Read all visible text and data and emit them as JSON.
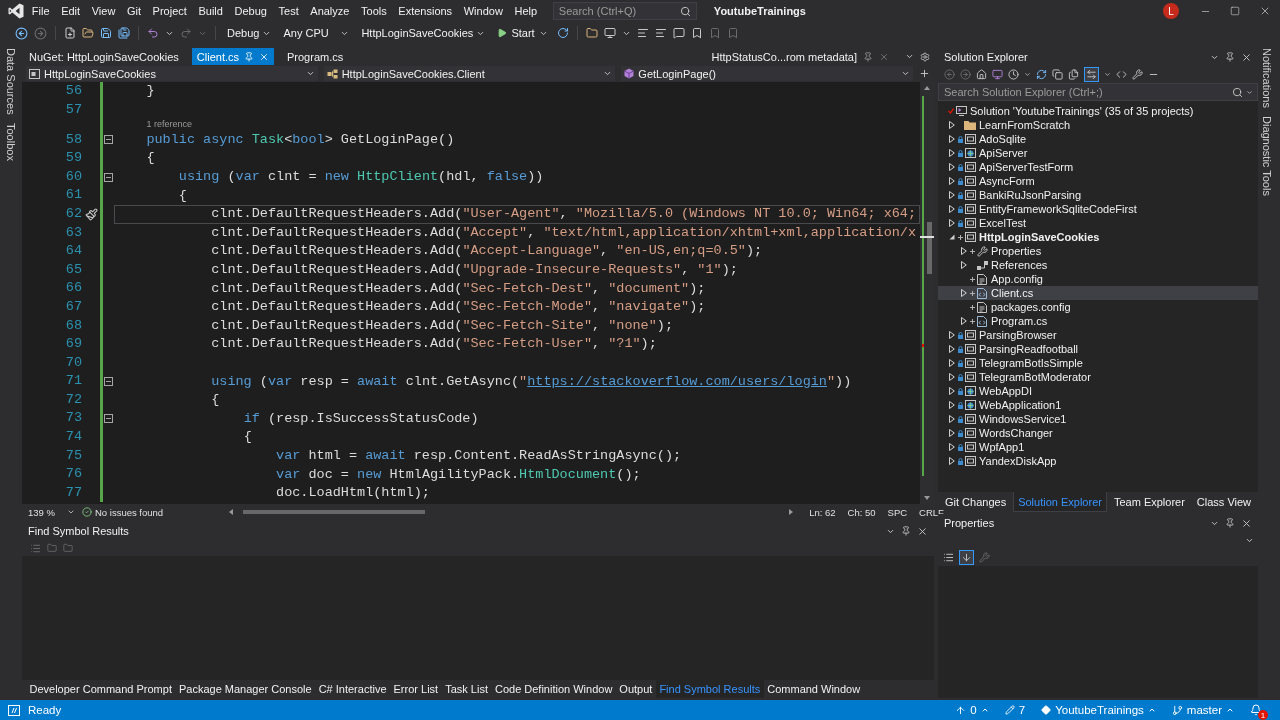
{
  "window": {
    "title": "YoutubeTrainings",
    "avatar": "L"
  },
  "menu": [
    "File",
    "Edit",
    "View",
    "Git",
    "Project",
    "Build",
    "Debug",
    "Test",
    "Analyze",
    "Tools",
    "Extensions",
    "Window",
    "Help"
  ],
  "search": {
    "placeholder": "Search (Ctrl+Q)"
  },
  "toolbar": {
    "configuration": "Debug",
    "platform": "Any CPU",
    "startup_project": "HttpLoginSaveCookies",
    "start": "Start"
  },
  "left_strip": [
    "Data Sources",
    "Toolbox"
  ],
  "editor": {
    "tabs": [
      {
        "label": "NuGet: HttpLoginSaveCookies",
        "selected": false
      },
      {
        "label": "Client.cs",
        "selected": true
      },
      {
        "label": "Program.cs",
        "selected": false
      }
    ],
    "preview_tab": {
      "label": "HttpStatusCo...rom metadata]"
    },
    "nav": [
      {
        "kind": "project",
        "label": "HttpLoginSaveCookies"
      },
      {
        "kind": "class",
        "label": "HttpLoginSaveCookies.Client"
      },
      {
        "kind": "method",
        "label": "GetLoginPage()"
      }
    ],
    "lines": [
      {
        "number": "56",
        "highlighted": false,
        "tokens": [
          {
            "kind": "plain",
            "text": "    }"
          }
        ]
      },
      {
        "number": "57",
        "highlighted": false
      },
      {
        "number": "58",
        "highlighted": false,
        "expanded": true,
        "codelens": "1 reference",
        "tokens": [
          {
            "kind": "keyword",
            "text": "    public async"
          },
          {
            "kind": "type",
            "text": " Task"
          },
          {
            "kind": "plain",
            "text": "<"
          },
          {
            "kind": "keyword",
            "text": "bool"
          },
          {
            "kind": "plain",
            "text": "> GetLoginPage()"
          }
        ]
      },
      {
        "number": "59",
        "highlighted": false,
        "tokens": [
          {
            "kind": "plain",
            "text": "    {"
          }
        ]
      },
      {
        "number": "60",
        "highlighted": false,
        "expanded": true,
        "tokens": [
          {
            "kind": "keyword",
            "text": "        using"
          },
          {
            "kind": "plain",
            "text": " ("
          },
          {
            "kind": "keyword",
            "text": "var"
          },
          {
            "kind": "plain",
            "text": " clnt = "
          },
          {
            "kind": "keyword",
            "text": "new"
          },
          {
            "kind": "type",
            "text": " HttpClient"
          },
          {
            "kind": "plain",
            "text": "(hdl, "
          },
          {
            "kind": "keyword",
            "text": "false"
          },
          {
            "kind": "plain",
            "text": "))"
          }
        ]
      },
      {
        "number": "61",
        "highlighted": false,
        "tokens": [
          {
            "kind": "plain",
            "text": "        {"
          }
        ]
      },
      {
        "number": "62",
        "highlighted": true,
        "tokens": [
          {
            "kind": "plain",
            "text": "            clnt.DefaultRequestHeaders.Add("
          },
          {
            "kind": "string",
            "text": "\"User-Agent\""
          },
          {
            "kind": "plain",
            "text": ", "
          },
          {
            "kind": "string",
            "text": "\"Mozilla/5.0 (Windows NT 10.0; Win64; x64;"
          }
        ]
      },
      {
        "number": "63",
        "highlighted": false,
        "tokens": [
          {
            "kind": "plain",
            "text": "            clnt.DefaultRequestHeaders.Add("
          },
          {
            "kind": "string",
            "text": "\"Accept\""
          },
          {
            "kind": "plain",
            "text": ", "
          },
          {
            "kind": "string",
            "text": "\"text/html,application/xhtml+xml,application/x"
          }
        ]
      },
      {
        "number": "64",
        "highlighted": false,
        "tokens": [
          {
            "kind": "plain",
            "text": "            clnt.DefaultRequestHeaders.Add("
          },
          {
            "kind": "string",
            "text": "\"Accept-Language\""
          },
          {
            "kind": "plain",
            "text": ", "
          },
          {
            "kind": "string",
            "text": "\"en-US,en;q=0.5\""
          },
          {
            "kind": "plain",
            "text": ");"
          }
        ]
      },
      {
        "number": "65",
        "highlighted": false,
        "tokens": [
          {
            "kind": "plain",
            "text": "            clnt.DefaultRequestHeaders.Add("
          },
          {
            "kind": "string",
            "text": "\"Upgrade-Insecure-Requests\""
          },
          {
            "kind": "plain",
            "text": ", "
          },
          {
            "kind": "string",
            "text": "\"1\""
          },
          {
            "kind": "plain",
            "text": ");"
          }
        ]
      },
      {
        "number": "66",
        "highlighted": false,
        "tokens": [
          {
            "kind": "plain",
            "text": "            clnt.DefaultRequestHeaders.Add("
          },
          {
            "kind": "string",
            "text": "\"Sec-Fetch-Dest\""
          },
          {
            "kind": "plain",
            "text": ", "
          },
          {
            "kind": "string",
            "text": "\"document\""
          },
          {
            "kind": "plain",
            "text": ");"
          }
        ]
      },
      {
        "number": "67",
        "highlighted": false,
        "tokens": [
          {
            "kind": "plain",
            "text": "            clnt.DefaultRequestHeaders.Add("
          },
          {
            "kind": "string",
            "text": "\"Sec-Fetch-Mode\""
          },
          {
            "kind": "plain",
            "text": ", "
          },
          {
            "kind": "string",
            "text": "\"navigate\""
          },
          {
            "kind": "plain",
            "text": ");"
          }
        ]
      },
      {
        "number": "68",
        "highlighted": false,
        "tokens": [
          {
            "kind": "plain",
            "text": "            clnt.DefaultRequestHeaders.Add("
          },
          {
            "kind": "string",
            "text": "\"Sec-Fetch-Site\""
          },
          {
            "kind": "plain",
            "text": ", "
          },
          {
            "kind": "string",
            "text": "\"none\""
          },
          {
            "kind": "plain",
            "text": ");"
          }
        ]
      },
      {
        "number": "69",
        "highlighted": false,
        "tokens": [
          {
            "kind": "plain",
            "text": "            clnt.DefaultRequestHeaders.Add("
          },
          {
            "kind": "string",
            "text": "\"Sec-Fetch-User\""
          },
          {
            "kind": "plain",
            "text": ", "
          },
          {
            "kind": "string",
            "text": "\"?1\""
          },
          {
            "kind": "plain",
            "text": ");"
          }
        ]
      },
      {
        "number": "70",
        "highlighted": false
      },
      {
        "number": "71",
        "highlighted": false,
        "expanded": true,
        "tokens": [
          {
            "kind": "keyword",
            "text": "            using"
          },
          {
            "kind": "plain",
            "text": " ("
          },
          {
            "kind": "keyword",
            "text": "var"
          },
          {
            "kind": "plain",
            "text": " resp = "
          },
          {
            "kind": "keyword",
            "text": "await"
          },
          {
            "kind": "plain",
            "text": " clnt.GetAsync("
          },
          {
            "kind": "string",
            "text": "\""
          },
          {
            "kind": "link",
            "text": "https://stackoverflow.com/users/login"
          },
          {
            "kind": "string",
            "text": "\""
          },
          {
            "kind": "plain",
            "text": "))"
          }
        ]
      },
      {
        "number": "72",
        "highlighted": false,
        "tokens": [
          {
            "kind": "plain",
            "text": "            {"
          }
        ]
      },
      {
        "number": "73",
        "highlighted": false,
        "expanded": true,
        "tokens": [
          {
            "kind": "keyword",
            "text": "                if"
          },
          {
            "kind": "plain",
            "text": " (resp.IsSuccessStatusCode)"
          }
        ]
      },
      {
        "number": "74",
        "highlighted": false,
        "tokens": [
          {
            "kind": "plain",
            "text": "                {"
          }
        ]
      },
      {
        "number": "75",
        "highlighted": false,
        "tokens": [
          {
            "kind": "keyword",
            "text": "                    var"
          },
          {
            "kind": "plain",
            "text": " html = "
          },
          {
            "kind": "keyword",
            "text": "await"
          },
          {
            "kind": "plain",
            "text": " resp.Content.ReadAsStringAsync();"
          }
        ]
      },
      {
        "number": "76",
        "highlighted": false,
        "tokens": [
          {
            "kind": "keyword",
            "text": "                    var"
          },
          {
            "kind": "plain",
            "text": " doc = "
          },
          {
            "kind": "keyword",
            "text": "new"
          },
          {
            "kind": "plain",
            "text": " HtmlAgilityPack."
          },
          {
            "kind": "type",
            "text": "HtmlDocument"
          },
          {
            "kind": "plain",
            "text": "();"
          }
        ]
      },
      {
        "number": "77",
        "highlighted": false,
        "tokens": [
          {
            "kind": "plain",
            "text": "                    doc.LoadHtml(html);"
          }
        ]
      }
    ],
    "status": {
      "zoom": "139 %",
      "issues": "No issues found",
      "line": "Ln: 62",
      "column": "Ch: 50",
      "indent": "SPC",
      "line_ending": "CRLF"
    }
  },
  "find_symbol_results": {
    "title": "Find Symbol Results"
  },
  "bottom_tabs": [
    {
      "label": "Developer Command Prompt",
      "selected": false
    },
    {
      "label": "Package Manager Console",
      "selected": false
    },
    {
      "label": "C# Interactive",
      "selected": false
    },
    {
      "label": "Error List",
      "selected": false
    },
    {
      "label": "Task List",
      "selected": false
    },
    {
      "label": "Code Definition Window",
      "selected": false
    },
    {
      "label": "Output",
      "selected": false
    },
    {
      "label": "Find Symbol Results",
      "selected": true
    },
    {
      "label": "Command Window",
      "selected": false
    }
  ],
  "solution_explorer": {
    "title": "Solution Explorer",
    "sync_active": true,
    "search": {
      "placeholder": "Search Solution Explorer (Ctrl+;)"
    },
    "tree": [
      {
        "label": "Solution 'YoutubeTrainings' (35 of 35 projects)",
        "kind": "solution",
        "modified": true,
        "selected": false,
        "children": [
          {
            "label": "LearnFromScratch",
            "kind": "folder",
            "expanded": false,
            "selected": false
          },
          {
            "label": "AdoSqlite",
            "kind": "project",
            "checked_in": true,
            "expanded": false,
            "selected": false
          },
          {
            "label": "ApiServer",
            "kind": "web_project",
            "checked_in": true,
            "expanded": false,
            "selected": false
          },
          {
            "label": "ApiServerTestForm",
            "kind": "project",
            "checked_in": true,
            "expanded": false,
            "selected": false
          },
          {
            "label": "AsyncForm",
            "kind": "project",
            "checked_in": true,
            "expanded": false,
            "selected": false
          },
          {
            "label": "BankiRuJsonParsing",
            "kind": "project",
            "checked_in": true,
            "expanded": false,
            "selected": false
          },
          {
            "label": "EntityFrameworkSqliteCodeFirst",
            "kind": "project",
            "checked_in": true,
            "expanded": false,
            "selected": false
          },
          {
            "label": "ExcelTest",
            "kind": "project",
            "checked_in": true,
            "expanded": false,
            "selected": false
          },
          {
            "label": "HttpLoginSaveCookies",
            "kind": "project",
            "added": true,
            "expanded": true,
            "selected": false,
            "startup": true,
            "children": [
              {
                "label": "Properties",
                "kind": "properties",
                "added": true,
                "expanded": false,
                "selected": false
              },
              {
                "label": "References",
                "kind": "references",
                "expanded": false,
                "selected": false
              },
              {
                "label": "App.config",
                "kind": "config",
                "added": true,
                "selected": false
              },
              {
                "label": "Client.cs",
                "kind": "csharp",
                "added": true,
                "expanded": false,
                "selected": true
              },
              {
                "label": "packages.config",
                "kind": "config",
                "added": true,
                "selected": false
              },
              {
                "label": "Program.cs",
                "kind": "csharp",
                "added": true,
                "expanded": false,
                "selected": false
              }
            ]
          },
          {
            "label": "ParsingBrowser",
            "kind": "project",
            "checked_in": true,
            "expanded": false,
            "selected": false
          },
          {
            "label": "ParsingReadfootball",
            "kind": "project",
            "checked_in": true,
            "expanded": false,
            "selected": false
          },
          {
            "label": "TelegramBotIsSimple",
            "kind": "project",
            "checked_in": true,
            "expanded": false,
            "selected": false
          },
          {
            "label": "TelegramBotModerator",
            "kind": "project",
            "checked_in": true,
            "expanded": false,
            "selected": false
          },
          {
            "label": "WebAppDI",
            "kind": "web_project",
            "checked_in": true,
            "expanded": false,
            "selected": false
          },
          {
            "label": "WebApplication1",
            "kind": "web_project",
            "checked_in": true,
            "expanded": false,
            "selected": false
          },
          {
            "label": "WindowsService1",
            "kind": "project",
            "checked_in": true,
            "expanded": false,
            "selected": false
          },
          {
            "label": "WordsChanger",
            "kind": "project",
            "checked_in": true,
            "expanded": false,
            "selected": false
          },
          {
            "label": "WpfApp1",
            "kind": "project",
            "checked_in": true,
            "expanded": false,
            "selected": false
          },
          {
            "label": "YandexDiskApp",
            "kind": "project",
            "checked_in": true,
            "expanded": false,
            "selected": false
          }
        ]
      }
    ]
  },
  "panel_tabs": [
    {
      "label": "Git Changes",
      "selected": false
    },
    {
      "label": "Solution Explorer",
      "selected": true
    },
    {
      "label": "Team Explorer",
      "selected": false
    },
    {
      "label": "Class View",
      "selected": false
    }
  ],
  "properties": {
    "title": "Properties",
    "alphabetical": true
  },
  "right_strip": [
    "Notifications",
    "Diagnostic Tools"
  ],
  "status_bar": {
    "message": "Ready",
    "outgoing": "0",
    "changes": "7",
    "repository": "YoutubeTrainings",
    "branch": "master",
    "notifications": "1"
  }
}
